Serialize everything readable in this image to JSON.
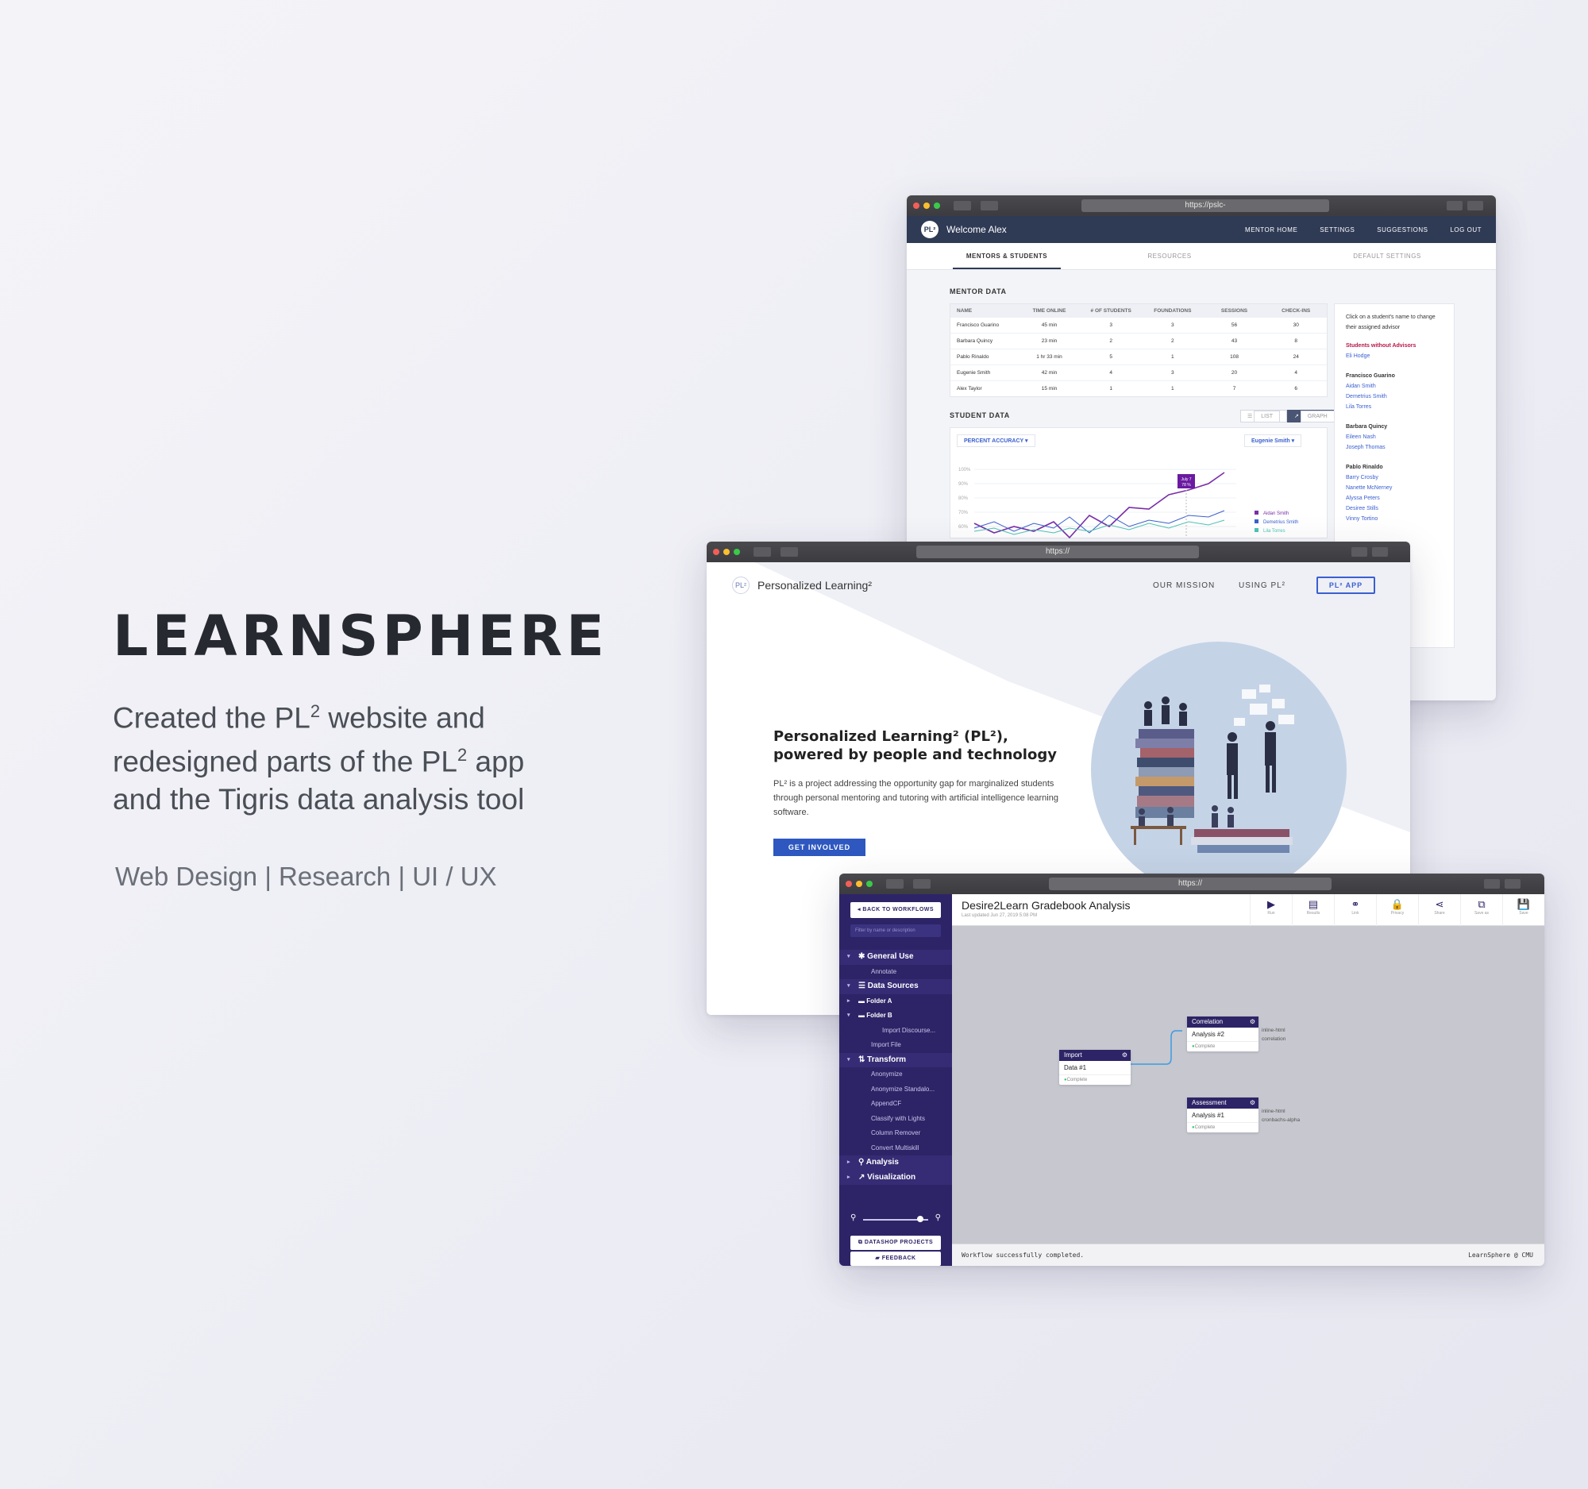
{
  "showcase": {
    "title": "LEARNSPHERE",
    "desc_line1_a": "Created the PL",
    "desc_line1_b": " website and",
    "desc_line2_a": "redesigned parts of the PL",
    "desc_line2_b": " app",
    "desc_line3": "and the Tigris data analysis tool",
    "superscript": "2",
    "tags": "Web Design | Research | UI / UX"
  },
  "mentor_app": {
    "url": "https://pslc-",
    "logo": "PL²",
    "welcome": "Welcome Alex",
    "nav": [
      "MENTOR HOME",
      "SETTINGS",
      "SUGGESTIONS",
      "LOG OUT"
    ],
    "tabs": [
      "MENTORS & STUDENTS",
      "RESOURCES",
      "DEFAULT SETTINGS"
    ],
    "mentor_heading": "MENTOR DATA",
    "table_headers": [
      "NAME",
      "TIME ONLINE",
      "# OF STUDENTS",
      "FOUNDATIONS",
      "SESSIONS",
      "CHECK-INS"
    ],
    "table_rows": [
      [
        "Francisco Guarino",
        "45 min",
        "3",
        "3",
        "56",
        "30"
      ],
      [
        "Barbara Quincy",
        "23 min",
        "2",
        "2",
        "43",
        "8"
      ],
      [
        "Pablo Rinaldo",
        "1 hr 33 min",
        "5",
        "1",
        "108",
        "24"
      ],
      [
        "Eugenie Smith",
        "42 min",
        "4",
        "3",
        "20",
        "4"
      ],
      [
        "Alex Taylor",
        "15 min",
        "1",
        "1",
        "7",
        "6"
      ]
    ],
    "student_heading": "STUDENT DATA",
    "toggle_list": "LIST",
    "toggle_graph": "GRAPH",
    "metric_select": "PERCENT ACCURACY",
    "mentor_select": "Eugenie Smith",
    "tooltip_line1": "July 7",
    "tooltip_line2": "78 %",
    "y_ticks": [
      "100%",
      "90%",
      "80%",
      "70%",
      "60%"
    ],
    "legend": [
      "Aidan Smith",
      "Demetrius Smith",
      "Lila Torres"
    ],
    "series_colors": [
      "#7a2ea8",
      "#3a5fd0",
      "#4ec3b4"
    ],
    "side_note": "Click on a student's name to change their assigned advisor",
    "side_warning": "Students without Advisors",
    "side_unassigned": "Eli Hodge",
    "side_groups": [
      {
        "mentor": "Francisco Guarino",
        "students": [
          "Aidan Smith",
          "Demetrius Smith",
          "Lila Torres"
        ]
      },
      {
        "mentor": "Barbara Quincy",
        "students": [
          "Eileen Nash",
          "Joseph Thomas"
        ]
      },
      {
        "mentor": "Pablo Rinaldo",
        "students": [
          "Barry Crosby",
          "Nanette McNerney",
          "Alyssa Peters",
          "Desiree Stills",
          "Vinny Tortino"
        ]
      }
    ]
  },
  "pl2_site": {
    "url": "https://",
    "logo": "PL²",
    "brand": "Personalized Learning²",
    "nav_mission": "OUR MISSION",
    "nav_using": "USING PL²",
    "app_button": "PL² APP",
    "headline": "Personalized Learning² (PL²), powered by people and technology",
    "body": "PL² is a project addressing the opportunity gap for marginalized students through personal mentoring and tutoring with artificial intelligence learning software.",
    "cta": "GET INVOLVED"
  },
  "tigris": {
    "url": "https://",
    "back": "BACK TO WORKFLOWS",
    "filter_placeholder": "Filter by name or description",
    "tree": [
      {
        "kind": "sec",
        "label": "General Use",
        "arrow": "▾",
        "icon": "✱"
      },
      {
        "kind": "leaf",
        "label": "Annotate"
      },
      {
        "kind": "sec",
        "label": "Data Sources",
        "arrow": "▾",
        "icon": "☰"
      },
      {
        "kind": "sub",
        "label": "Folder A",
        "arrow": "▸",
        "icon": "▬"
      },
      {
        "kind": "sub",
        "label": "Folder B",
        "arrow": "▾",
        "icon": "▬"
      },
      {
        "kind": "leaf2",
        "label": "Import Discourse..."
      },
      {
        "kind": "leaf",
        "label": "Import File"
      },
      {
        "kind": "sec",
        "label": "Transform",
        "arrow": "▾",
        "icon": "⇅"
      },
      {
        "kind": "leaf",
        "label": "Anonymize"
      },
      {
        "kind": "leaf",
        "label": "Anonymize Standalo..."
      },
      {
        "kind": "leaf",
        "label": "AppendCF"
      },
      {
        "kind": "leaf",
        "label": "Classify with Lights"
      },
      {
        "kind": "leaf",
        "label": "Column Remover"
      },
      {
        "kind": "leaf",
        "label": "Convert Multiskill"
      },
      {
        "kind": "sec",
        "label": "Analysis",
        "arrow": "▸",
        "icon": "⚲"
      },
      {
        "kind": "sec",
        "label": "Visualization",
        "arrow": "▸",
        "icon": "↗"
      }
    ],
    "datashop": "DATASHOP PROJECTS",
    "feedback": "FEEDBACK",
    "title": "Desire2Learn Gradebook Analysis",
    "subtitle": "Last updated Jun 27, 2019 5:08 PM",
    "toolbar": [
      {
        "label": "Run",
        "icon": "▶"
      },
      {
        "label": "Results",
        "icon": "▤"
      },
      {
        "label": "Link",
        "icon": "⚭"
      },
      {
        "label": "Privacy",
        "icon": "🔒"
      },
      {
        "label": "Share",
        "icon": "⋖"
      },
      {
        "label": "Save as",
        "icon": "⧉"
      },
      {
        "label": "Save",
        "icon": "💾"
      }
    ],
    "nodes": {
      "import": {
        "header": "Import",
        "body": "Data #1",
        "status": "Complete"
      },
      "correlation": {
        "header": "Correlation",
        "body": "Analysis #2",
        "status": "Complete",
        "ports": [
          "inline-html",
          "correlation"
        ]
      },
      "assessment": {
        "header": "Assessment",
        "body": "Analysis #1",
        "status": "Complete",
        "ports": [
          "inline-html",
          "cronbachs-alpha"
        ]
      }
    },
    "status_message": "Workflow successfully completed.",
    "footer_brand": "LearnSphere @ CMU"
  }
}
